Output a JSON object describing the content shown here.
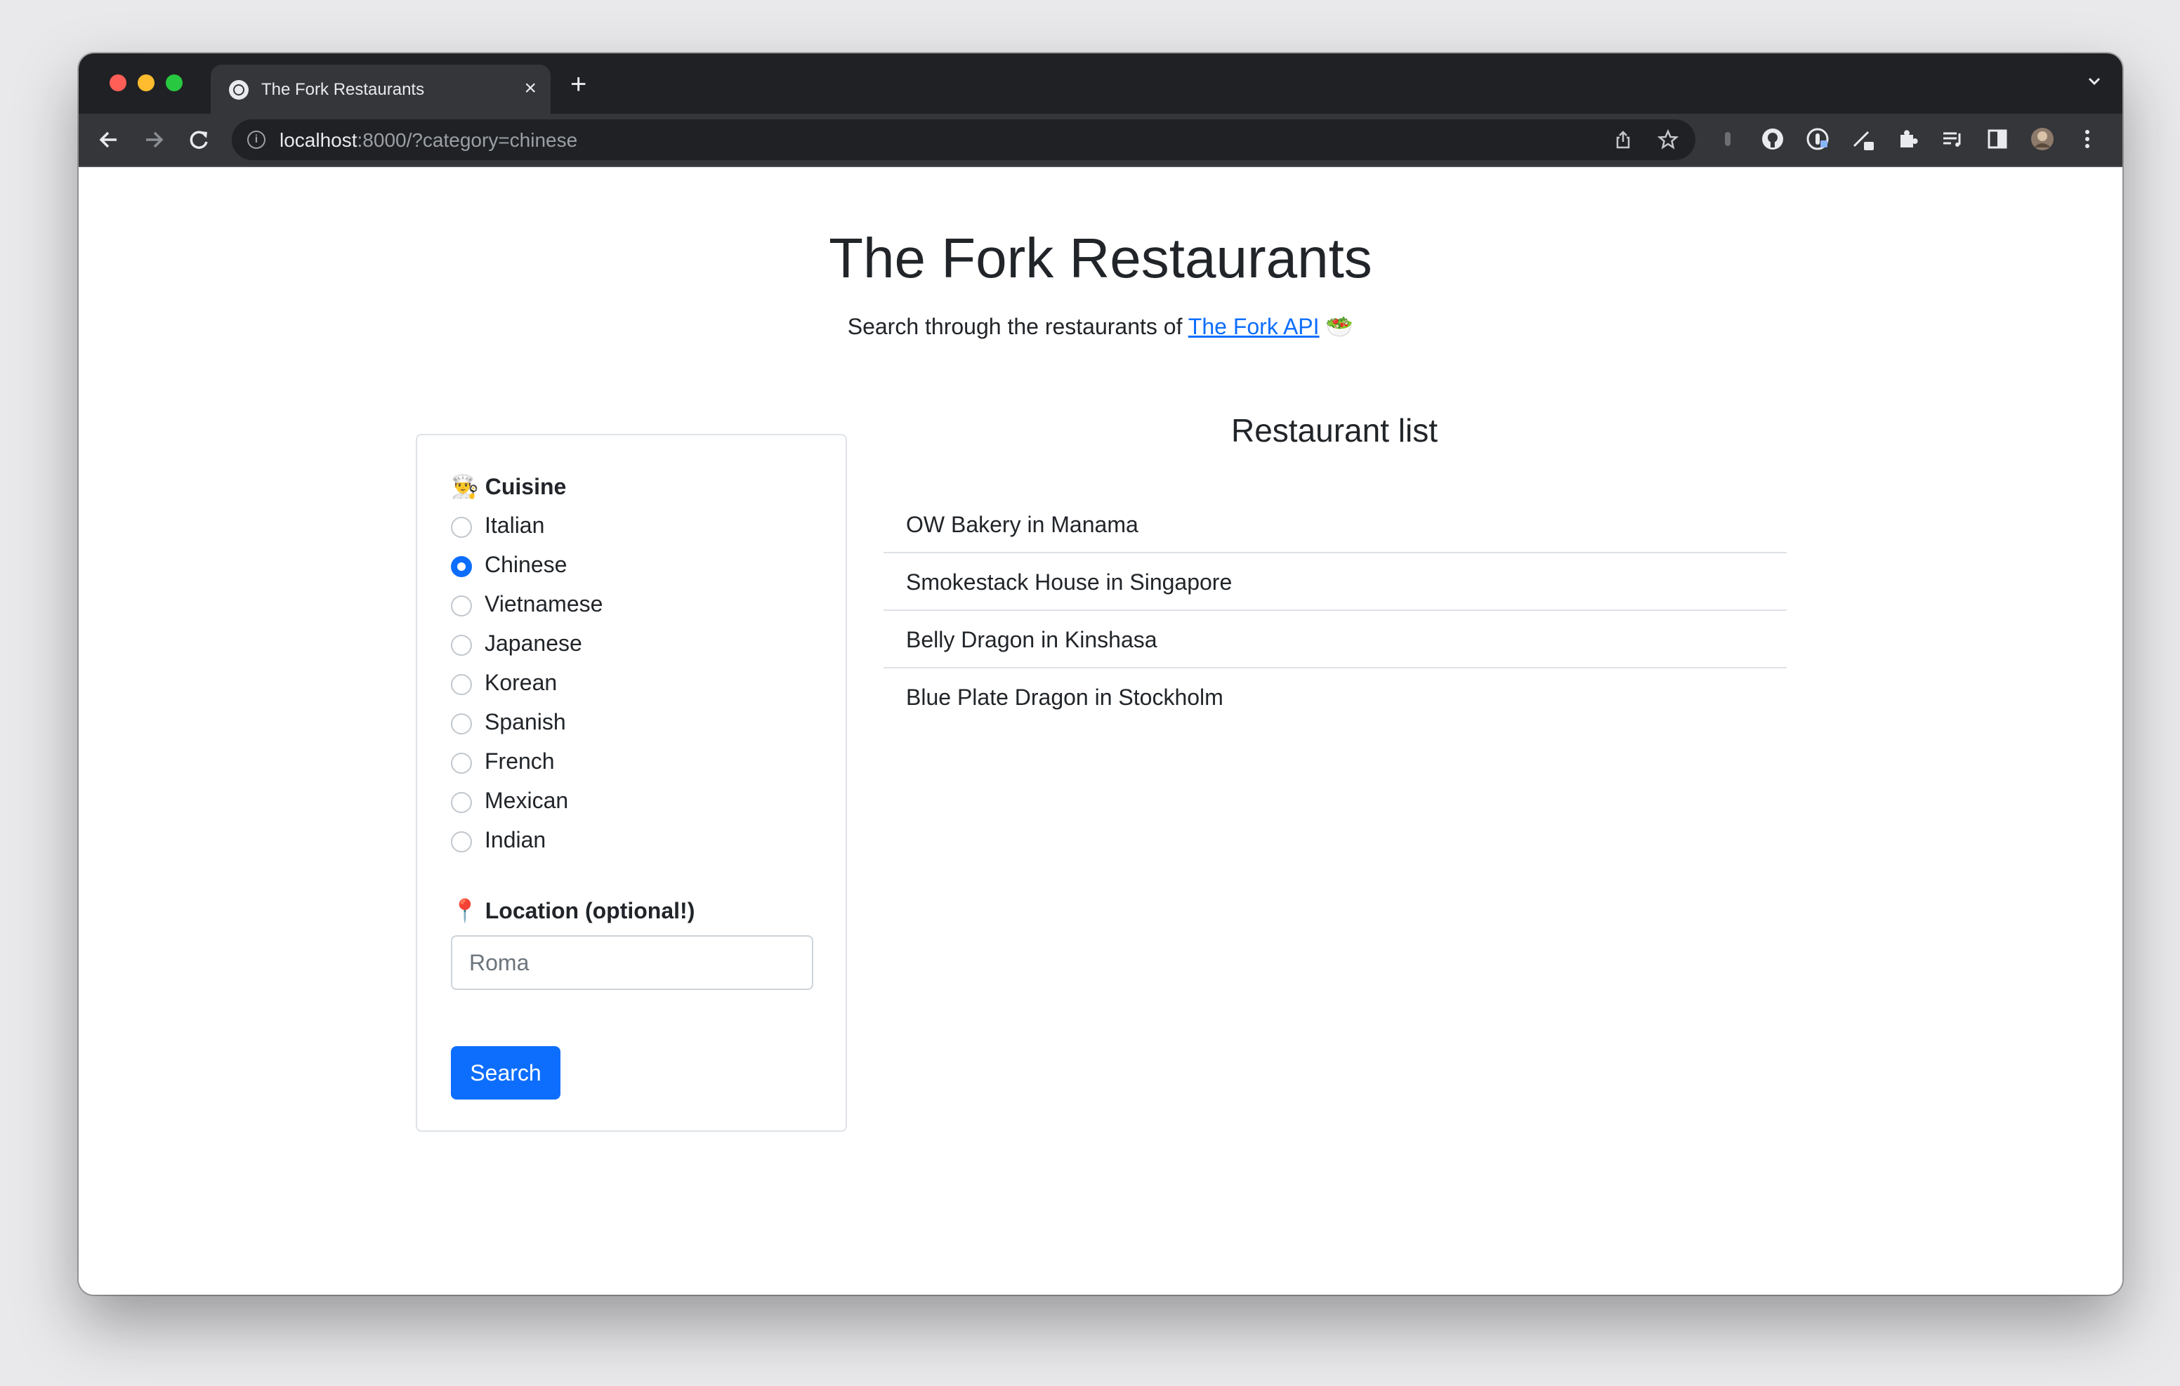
{
  "browser": {
    "tab_title": "The Fork Restaurants",
    "tab_close": "×",
    "new_tab": "+",
    "url_host": "localhost",
    "url_rest": ":8000/?category=chinese",
    "info_glyph": "i"
  },
  "page": {
    "title": "The Fork Restaurants",
    "subtitle_prefix": "Search through the restaurants of ",
    "subtitle_link": "The Fork API",
    "subtitle_emoji": "🥗"
  },
  "form": {
    "cuisine_emoji": "👨‍🍳",
    "cuisine_label": "Cuisine",
    "cuisines": [
      {
        "label": "Italian",
        "checked": false
      },
      {
        "label": "Chinese",
        "checked": true
      },
      {
        "label": "Vietnamese",
        "checked": false
      },
      {
        "label": "Japanese",
        "checked": false
      },
      {
        "label": "Korean",
        "checked": false
      },
      {
        "label": "Spanish",
        "checked": false
      },
      {
        "label": "French",
        "checked": false
      },
      {
        "label": "Mexican",
        "checked": false
      },
      {
        "label": "Indian",
        "checked": false
      }
    ],
    "location_emoji": "📍",
    "location_label": "Location (optional!)",
    "location_placeholder": "Roma",
    "location_value": "",
    "search_label": "Search"
  },
  "results": {
    "heading": "Restaurant list",
    "items": [
      "OW Bakery in Manama",
      "Smokestack House in Singapore",
      "Belly Dragon in Kinshasa",
      "Blue Plate Dragon in Stockholm"
    ]
  },
  "colors": {
    "primary": "#0d6efd",
    "browser_frame": "#202124",
    "browser_toolbar": "#35363a"
  }
}
